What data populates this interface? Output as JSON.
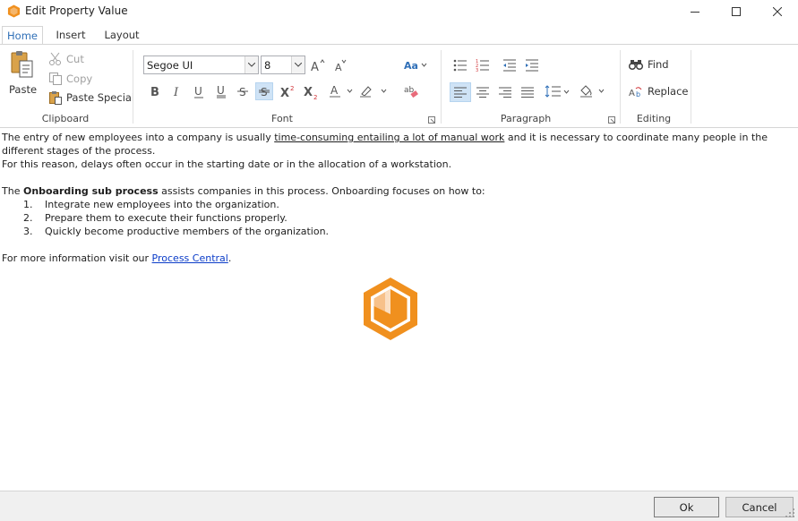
{
  "window": {
    "title": "Edit Property Value"
  },
  "tabs": [
    {
      "label": "Home",
      "active": true
    },
    {
      "label": "Insert",
      "active": false
    },
    {
      "label": "Layout",
      "active": false
    }
  ],
  "ribbon": {
    "clipboard": {
      "label": "Clipboard",
      "paste_label": "Paste",
      "cut_label": "Cut",
      "copy_label": "Copy",
      "paste_special_label": "Paste Special"
    },
    "font": {
      "label": "Font",
      "font_name": "Segoe UI",
      "font_size": "8"
    },
    "paragraph": {
      "label": "Paragraph"
    },
    "editing": {
      "label": "Editing",
      "find_label": "Find",
      "replace_label": "Replace"
    }
  },
  "document": {
    "p1_before": "The entry of new employees into a company is usually ",
    "p1_underlined": "time-consuming entailing a lot of manual work",
    "p1_after": " and it is necessary to coordinate many people in the different stages of the process.",
    "p2": "For this reason, delays often occur in the starting date or in the allocation of a workstation.",
    "p3_before": "The ",
    "p3_bold": "Onboarding sub process",
    "p3_after": " assists companies in this process. Onboarding focuses on how to:",
    "list": [
      {
        "num": "1.",
        "text": "Integrate new employees into the organization."
      },
      {
        "num": "2.",
        "text": "Prepare them to execute their functions properly."
      },
      {
        "num": "3.",
        "text": "Quickly become productive members of the organization."
      }
    ],
    "p4_before": "For more information visit our ",
    "p4_link": "Process Central",
    "p4_after": "."
  },
  "footer": {
    "ok_label": "Ok",
    "cancel_label": "Cancel"
  },
  "colors": {
    "accent": "#2f6fb7",
    "logo_orange": "#f0901e",
    "link": "#0b3cc8"
  }
}
